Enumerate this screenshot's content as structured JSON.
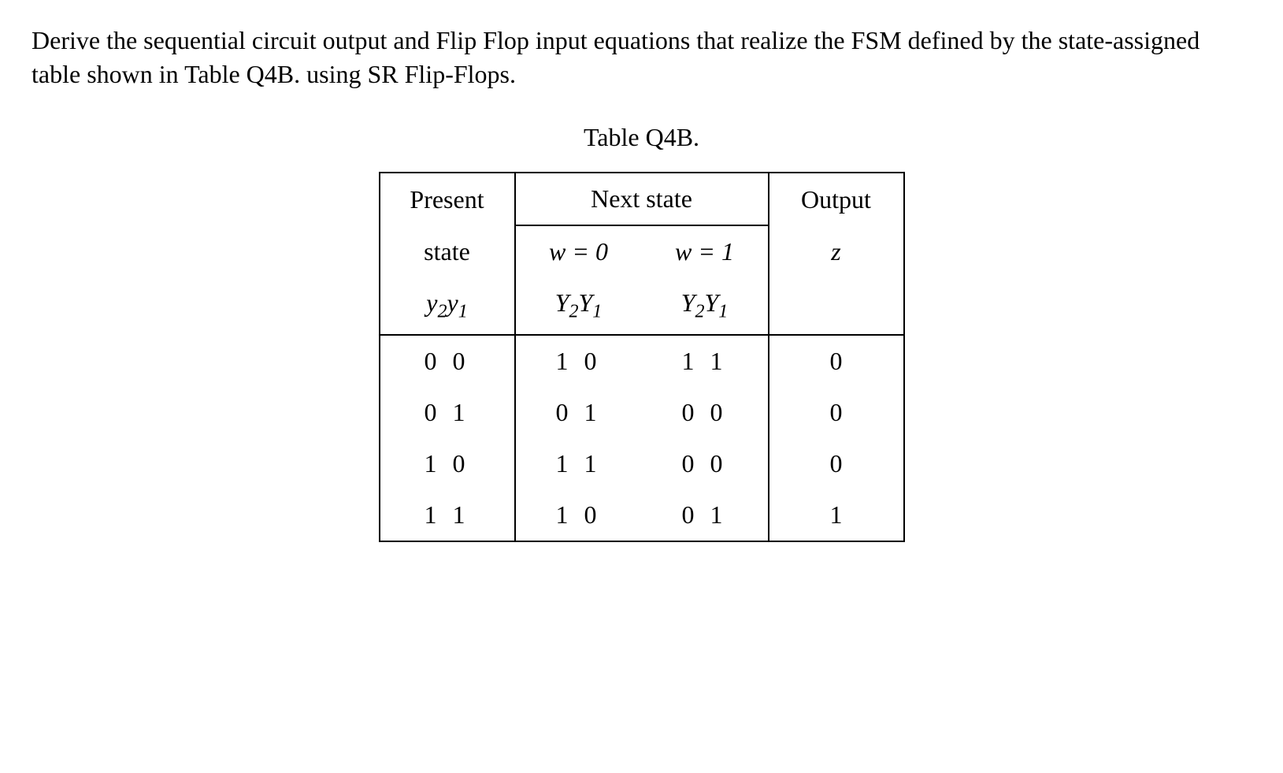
{
  "question": "Derive the sequential circuit output and Flip Flop input equations that realize the FSM defined by the state-assigned table shown in Table Q4B. using SR Flip-Flops.",
  "table_caption": "Table Q4B.",
  "headers": {
    "present_state_line1": "Present",
    "present_state_line2": "state",
    "next_state": "Next state",
    "w0": "w = 0",
    "w1": "w = 1",
    "output": "Output",
    "present_var": "y₂y₁",
    "next_var_w0": "Y₂Y₁",
    "next_var_w1": "Y₂Y₁",
    "output_var": "z"
  },
  "chart_data": {
    "type": "table",
    "title": "Table Q4B.",
    "columns": [
      "Present state y2y1",
      "Next state (w=0) Y2Y1",
      "Next state (w=1) Y2Y1",
      "Output z"
    ],
    "rows": [
      {
        "present": "0 0",
        "next_w0": "1 0",
        "next_w1": "1 1",
        "output": "0"
      },
      {
        "present": "0 1",
        "next_w0": "0 1",
        "next_w1": "0 0",
        "output": "0"
      },
      {
        "present": "1 0",
        "next_w0": "1 1",
        "next_w1": "0 0",
        "output": "0"
      },
      {
        "present": "1 1",
        "next_w0": "1 0",
        "next_w1": "0 1",
        "output": "1"
      }
    ]
  }
}
